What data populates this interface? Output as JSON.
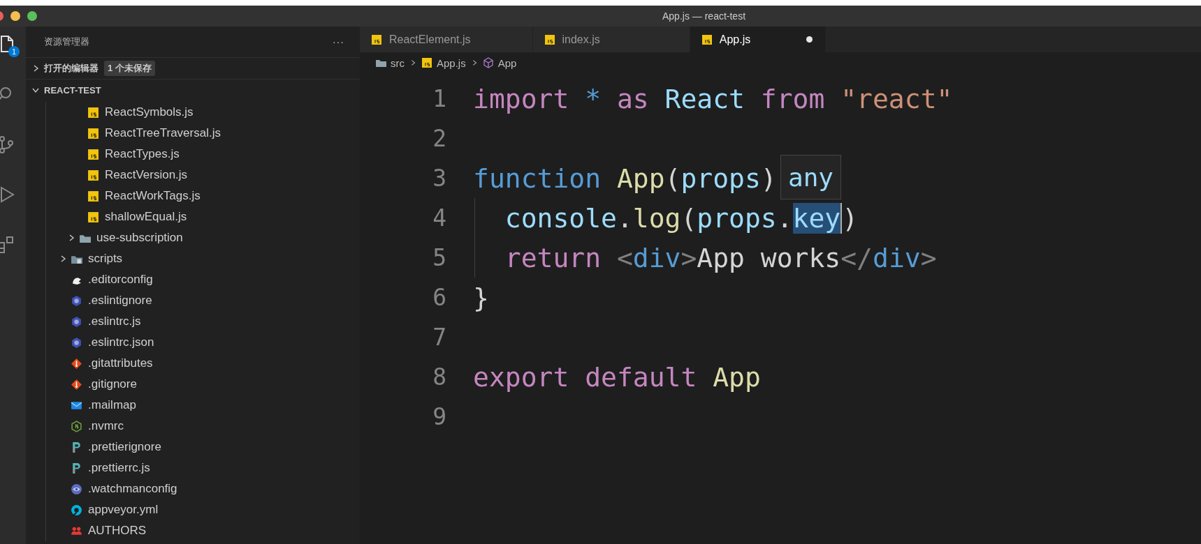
{
  "window": {
    "title": "App.js — react-test"
  },
  "activity_bar": [
    {
      "kind": "files",
      "selected": true,
      "badge": "1"
    },
    {
      "kind": "search",
      "selected": false
    },
    {
      "kind": "scm",
      "selected": false
    },
    {
      "kind": "run",
      "selected": false
    },
    {
      "kind": "extensions",
      "selected": false
    }
  ],
  "sidebar": {
    "title": "资源管理器",
    "more": "···",
    "open_editors": {
      "label": "打开的编辑器",
      "expanded": false,
      "badge": "1 个未保存"
    },
    "tree": {
      "label": "REACT-TEST",
      "expanded": true,
      "children": [
        {
          "children": [
            {
              "children": [
                {
                  "label": "ReactSymbols.js",
                  "kind": "js"
                },
                {
                  "label": "ReactTreeTraversal.js",
                  "kind": "js"
                },
                {
                  "label": "ReactTypes.js",
                  "kind": "js"
                },
                {
                  "label": "ReactVersion.js",
                  "kind": "js"
                },
                {
                  "label": "ReactWorkTags.js",
                  "kind": "js"
                },
                {
                  "label": "shallowEqual.js",
                  "kind": "js"
                }
              ]
            },
            {
              "label": "use-subscription",
              "kind": "folder",
              "expanded": false
            }
          ]
        },
        {
          "label": "scripts",
          "kind": "folder-scripts",
          "expanded": false
        },
        {
          "label": ".editorconfig",
          "kind": "editorconfig"
        },
        {
          "label": ".eslintignore",
          "kind": "eslint"
        },
        {
          "label": ".eslintrc.js",
          "kind": "eslint"
        },
        {
          "label": ".eslintrc.json",
          "kind": "eslint"
        },
        {
          "label": ".gitattributes",
          "kind": "git"
        },
        {
          "label": ".gitignore",
          "kind": "git"
        },
        {
          "label": ".mailmap",
          "kind": "mail"
        },
        {
          "label": ".nvmrc",
          "kind": "node"
        },
        {
          "label": ".prettierignore",
          "kind": "prettier"
        },
        {
          "label": ".prettierrc.js",
          "kind": "prettier"
        },
        {
          "label": ".watchmanconfig",
          "kind": "watchman"
        },
        {
          "label": "appveyor.yml",
          "kind": "appveyor"
        },
        {
          "label": "AUTHORS",
          "kind": "authors"
        }
      ]
    }
  },
  "tabs": [
    {
      "label": "ReactElement.js",
      "selected": false,
      "dirty": false
    },
    {
      "label": "index.js",
      "selected": false,
      "dirty": false
    },
    {
      "label": "App.js",
      "selected": true,
      "dirty": true
    }
  ],
  "breadcrumb": [
    {
      "label": "src",
      "kind": "folder"
    },
    {
      "label": "App.js",
      "kind": "js"
    },
    {
      "label": "App",
      "kind": "symbol"
    }
  ],
  "code": [
    {
      "number": "1",
      "tokens": [
        {
          "text": "import",
          "kind": "keyword"
        },
        {
          "text": " *",
          "kind": "operator"
        },
        {
          "text": " as",
          "kind": "keyword"
        },
        {
          "text": " React",
          "kind": "variable"
        },
        {
          "text": " from",
          "kind": "keyword"
        },
        {
          "text": " \"react\"",
          "kind": "string"
        }
      ]
    },
    {
      "number": "2"
    },
    {
      "number": "3",
      "tokens": [
        {
          "text": "function",
          "kind": "storage"
        },
        {
          "text": " App",
          "kind": "function"
        },
        {
          "text": "(",
          "kind": "plain"
        },
        {
          "text": "props",
          "kind": "variable"
        },
        {
          "text": ")",
          "kind": "plain"
        }
      ],
      "hover": "any"
    },
    {
      "number": "4",
      "indented": true,
      "tokens": [
        {
          "text": "console",
          "kind": "variable"
        },
        {
          "text": ".",
          "kind": "plain"
        },
        {
          "text": "log",
          "kind": "function"
        },
        {
          "text": "(",
          "kind": "plain"
        },
        {
          "text": "props",
          "kind": "variable"
        },
        {
          "text": ".",
          "kind": "plain"
        },
        {
          "text": "key",
          "kind": "variable",
          "selected": true
        },
        {
          "text": ")",
          "kind": "plain"
        }
      ]
    },
    {
      "number": "5",
      "indented": true,
      "tokens": [
        {
          "text": "return",
          "kind": "keyword"
        },
        {
          "text": " <",
          "kind": "bracket"
        },
        {
          "text": "div",
          "kind": "tag"
        },
        {
          "text": ">",
          "kind": "bracket"
        },
        {
          "text": "App works",
          "kind": "plain"
        },
        {
          "text": "</",
          "kind": "bracket"
        },
        {
          "text": "div",
          "kind": "tag"
        },
        {
          "text": ">",
          "kind": "bracket"
        }
      ]
    },
    {
      "number": "6",
      "tokens": [
        {
          "text": "}",
          "kind": "plain"
        }
      ]
    },
    {
      "number": "7"
    },
    {
      "number": "8",
      "tokens": [
        {
          "text": "export",
          "kind": "keyword"
        },
        {
          "text": " default",
          "kind": "keyword"
        },
        {
          "text": " App",
          "kind": "function"
        }
      ]
    },
    {
      "number": "9"
    }
  ]
}
